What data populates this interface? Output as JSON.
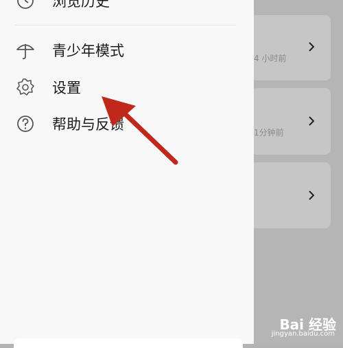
{
  "drawer": {
    "menu_items": [
      {
        "label": "浏览历史",
        "icon": "history-clock-icon"
      },
      {
        "label": "青少年模式",
        "icon": "umbrella-icon"
      },
      {
        "label": "设置",
        "icon": "gear-icon"
      },
      {
        "label": "帮助与反馈",
        "icon": "help-question-icon"
      }
    ]
  },
  "background_list": {
    "items": [
      {
        "time": "4 小时前"
      },
      {
        "time": "1分钟前"
      },
      {
        "time": ""
      }
    ]
  },
  "annotation": {
    "color": "#c0281c"
  },
  "watermark": {
    "main": "Bai 经验",
    "sub": "jingyan.baidu.com"
  }
}
